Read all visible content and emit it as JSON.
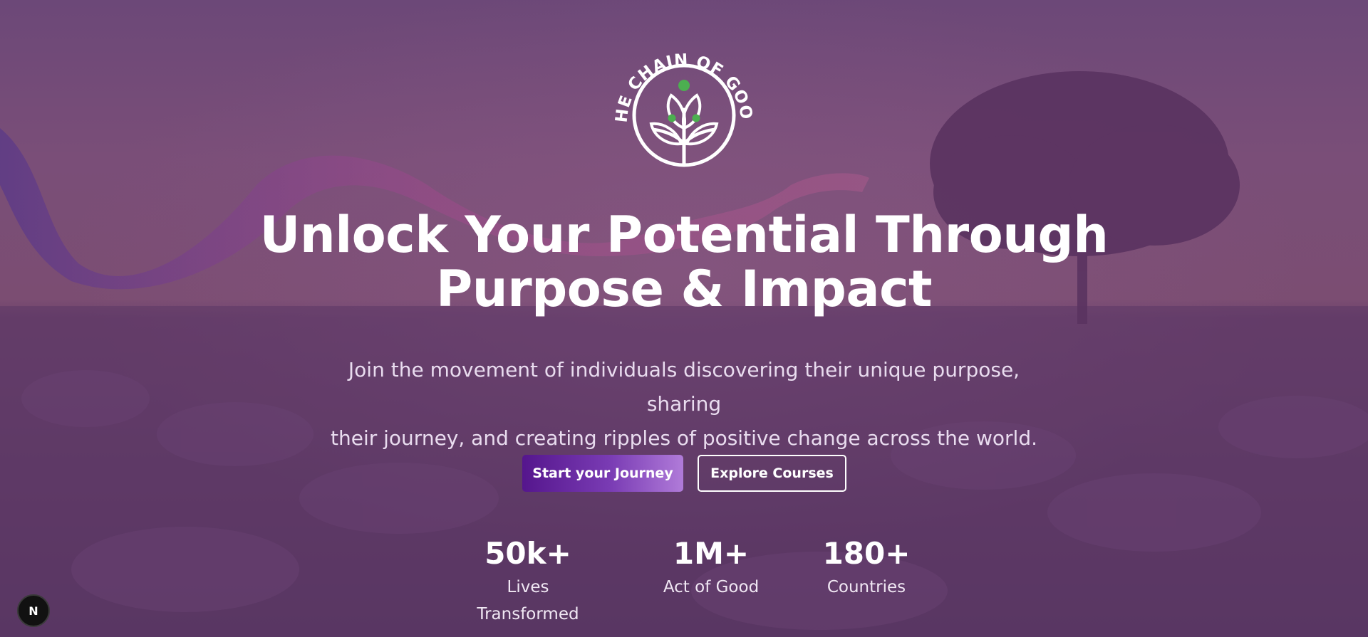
{
  "brand": {
    "logo_text": "THE CHAIN OF GOOD",
    "logo_icon": "sprout-in-circle-icon"
  },
  "hero": {
    "headline_line1": "Unlock Your Potential Through",
    "headline_line2": "Purpose & Impact",
    "subheadline_line1": "Join the movement of individuals discovering their unique purpose, sharing",
    "subheadline_line2": "their journey, and creating ripples of positive change across the world."
  },
  "actions": {
    "primary_label": "Start your Journey",
    "secondary_label": "Explore Courses"
  },
  "stats": [
    {
      "value": "50k+",
      "label": "Lives Transformed"
    },
    {
      "value": "1M+",
      "label": "Act of Good"
    },
    {
      "value": "180+",
      "label": "Countries"
    }
  ],
  "dev_badge": {
    "letter": "N",
    "icon": "nextjs-icon"
  },
  "colors": {
    "overlay": "#6a4576",
    "button_gradient_start": "#55168d",
    "button_gradient_end": "#b07bd9",
    "logo_dot_green": "#4caf50",
    "text": "#ffffff"
  }
}
